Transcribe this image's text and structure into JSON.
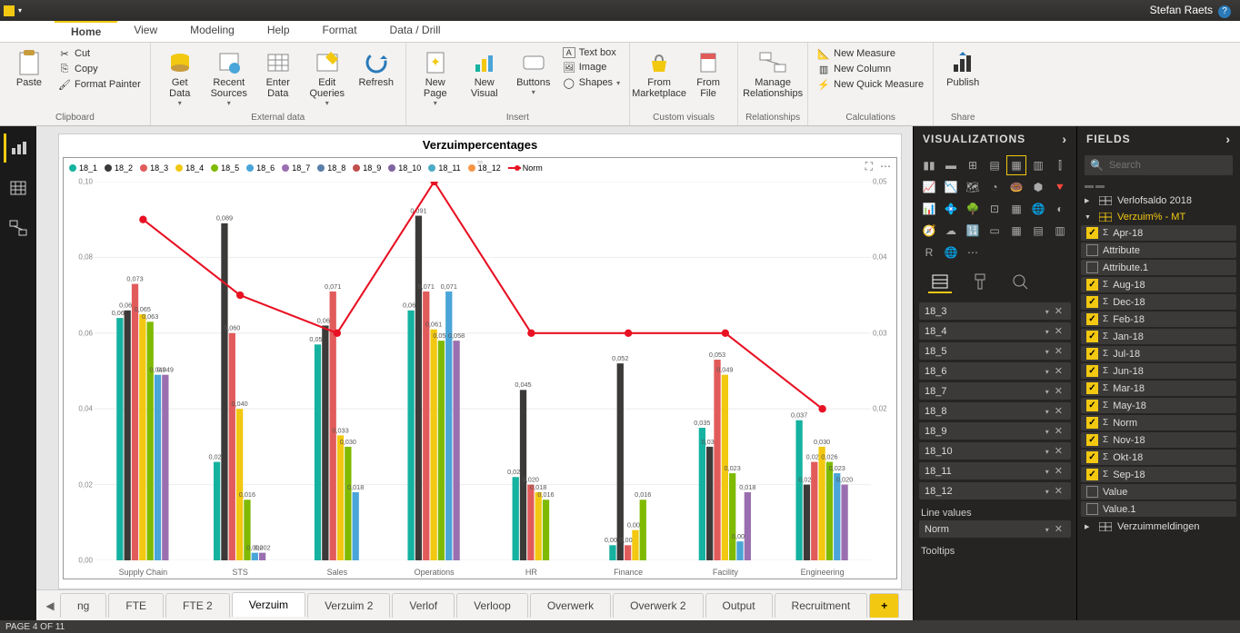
{
  "user": "Stefan Raets",
  "ribbon": {
    "tabs": [
      "Home",
      "View",
      "Modeling",
      "Help",
      "Format",
      "Data / Drill"
    ],
    "active": "Home",
    "clipboard": {
      "label": "Clipboard",
      "paste": "Paste",
      "cut": "Cut",
      "copy": "Copy",
      "fp": "Format Painter"
    },
    "externaldata": {
      "label": "External data",
      "getdata": "Get\nData",
      "recent": "Recent\nSources",
      "enter": "Enter\nData",
      "edit": "Edit\nQueries",
      "refresh": "Refresh"
    },
    "insert": {
      "label": "Insert",
      "newpage": "New\nPage",
      "newvisual": "New\nVisual",
      "buttons": "Buttons",
      "textbox": "Text box",
      "image": "Image",
      "shapes": "Shapes"
    },
    "custom": {
      "label": "Custom visuals",
      "market": "From\nMarketplace",
      "file": "From\nFile"
    },
    "rel": {
      "label": "Relationships",
      "manage": "Manage\nRelationships"
    },
    "calc": {
      "label": "Calculations",
      "measure": "New Measure",
      "column": "New Column",
      "quick": "New Quick Measure"
    },
    "share": {
      "label": "Share",
      "publish": "Publish"
    }
  },
  "chart_data": {
    "type": "bar",
    "title": "Verzuimpercentages",
    "series_names": [
      "18_1",
      "18_2",
      "18_3",
      "18_4",
      "18_5",
      "18_6",
      "18_7",
      "18_8",
      "18_9",
      "18_10",
      "18_11",
      "18_12"
    ],
    "norm_name": "Norm",
    "categories": [
      "Supply Chain",
      "STS",
      "Sales",
      "Operations",
      "HR",
      "Finance",
      "Facility",
      "Engineering"
    ],
    "ymax_left": 0.1,
    "ymax_right": 0.05,
    "yticks_left": [
      0.0,
      0.02,
      0.04,
      0.06,
      0.08,
      0.1
    ],
    "yticks_right": [
      0.02,
      0.03,
      0.04,
      0.05
    ],
    "norm": [
      0.045,
      0.035,
      0.03,
      0.05,
      0.03,
      0.03,
      0.03,
      0.02
    ],
    "bars": [
      {
        "values": [
          0.064,
          0.066,
          0.073,
          0.065,
          0.063,
          0.049,
          0.049
        ],
        "labels": [
          "0,064",
          "0,066",
          "0,073",
          "0,065",
          "0,063",
          "0,049",
          "0,049"
        ]
      },
      {
        "values": [
          0.026,
          0.089,
          0.06,
          0.04,
          0.016,
          0.002,
          0.002
        ],
        "labels": [
          "0,026",
          "0,089",
          "0,060",
          "0,040",
          "0,016",
          "0,002",
          "0,002"
        ]
      },
      {
        "values": [
          0.057,
          0.062,
          0.071,
          0.033,
          0.03,
          0.018
        ],
        "labels": [
          "0,057",
          "0,062",
          "0,071",
          "0,033",
          "0,030",
          "0,018"
        ]
      },
      {
        "values": [
          0.066,
          0.091,
          0.071,
          0.061,
          0.058,
          0.071,
          0.058
        ],
        "labels": [
          "0,066",
          "0,091",
          "0,071",
          "0,061",
          "0,058",
          "0,071",
          "0,058"
        ]
      },
      {
        "values": [
          0.022,
          0.045,
          0.02,
          0.018,
          0.016
        ],
        "labels": [
          "0,022",
          "0,045",
          "0,020",
          "0,018",
          "0,016"
        ]
      },
      {
        "values": [
          0.004,
          0.052,
          0.004,
          0.008,
          0.016
        ],
        "labels": [
          "0,004",
          "0,052",
          "0,004",
          "0,008",
          "0,016"
        ]
      },
      {
        "values": [
          0.035,
          0.03,
          0.053,
          0.049,
          0.023,
          0.005,
          0.018
        ],
        "labels": [
          "0,035",
          "0,030",
          "0,053",
          "0,049",
          "0,023",
          "0,005",
          "0,018"
        ]
      },
      {
        "values": [
          0.037,
          0.02,
          0.026,
          0.03,
          0.026,
          0.023,
          0.02
        ],
        "labels": [
          "0,037",
          "0,020",
          "0,026",
          "0,030",
          "0,026",
          "0,023",
          "0,020"
        ]
      }
    ],
    "colors": [
      "#15b2a0",
      "#3b3a39",
      "#e25b5b",
      "#f2c811",
      "#7fba00",
      "#4aa5d8",
      "#9a6fb0",
      "#5b7ea8",
      "#c0504d",
      "#8064a2",
      "#4bacc6",
      "#f79646"
    ],
    "norm_color": "#e81123"
  },
  "pagetabs": {
    "items": [
      "ng",
      "FTE",
      "FTE 2",
      "Verzuim",
      "Verzuim 2",
      "Verlof",
      "Verloop",
      "Overwerk",
      "Overwerk 2",
      "Output",
      "Recruitment"
    ],
    "active": "Verzuim"
  },
  "viz": {
    "header": "VISUALIZATIONS",
    "wells": [
      "18_3",
      "18_4",
      "18_5",
      "18_6",
      "18_7",
      "18_8",
      "18_9",
      "18_10",
      "18_11",
      "18_12"
    ],
    "line_label": "Line values",
    "line_item": "Norm",
    "tooltips_label": "Tooltips"
  },
  "fields": {
    "header": "FIELDS",
    "search_ph": "Search",
    "tables": [
      {
        "name": "Verlofsaldo 2018",
        "expanded": false,
        "selected": false
      },
      {
        "name": "Verzuim% - MT",
        "expanded": true,
        "selected": true
      }
    ],
    "cols": [
      {
        "name": "Apr-18",
        "checked": true,
        "sigma": true
      },
      {
        "name": "Attribute",
        "checked": false,
        "sigma": false
      },
      {
        "name": "Attribute.1",
        "checked": false,
        "sigma": false
      },
      {
        "name": "Aug-18",
        "checked": true,
        "sigma": true
      },
      {
        "name": "Dec-18",
        "checked": true,
        "sigma": true
      },
      {
        "name": "Feb-18",
        "checked": true,
        "sigma": true
      },
      {
        "name": "Jan-18",
        "checked": true,
        "sigma": true
      },
      {
        "name": "Jul-18",
        "checked": true,
        "sigma": true
      },
      {
        "name": "Jun-18",
        "checked": true,
        "sigma": true
      },
      {
        "name": "Mar-18",
        "checked": true,
        "sigma": true
      },
      {
        "name": "May-18",
        "checked": true,
        "sigma": true
      },
      {
        "name": "Norm",
        "checked": true,
        "sigma": true
      },
      {
        "name": "Nov-18",
        "checked": true,
        "sigma": true
      },
      {
        "name": "Okt-18",
        "checked": true,
        "sigma": true
      },
      {
        "name": "Sep-18",
        "checked": true,
        "sigma": true
      },
      {
        "name": "Value",
        "checked": false,
        "sigma": false
      },
      {
        "name": "Value.1",
        "checked": false,
        "sigma": false
      }
    ],
    "last_table": "Verzuimmeldingen"
  },
  "status": "PAGE 4 OF 11"
}
